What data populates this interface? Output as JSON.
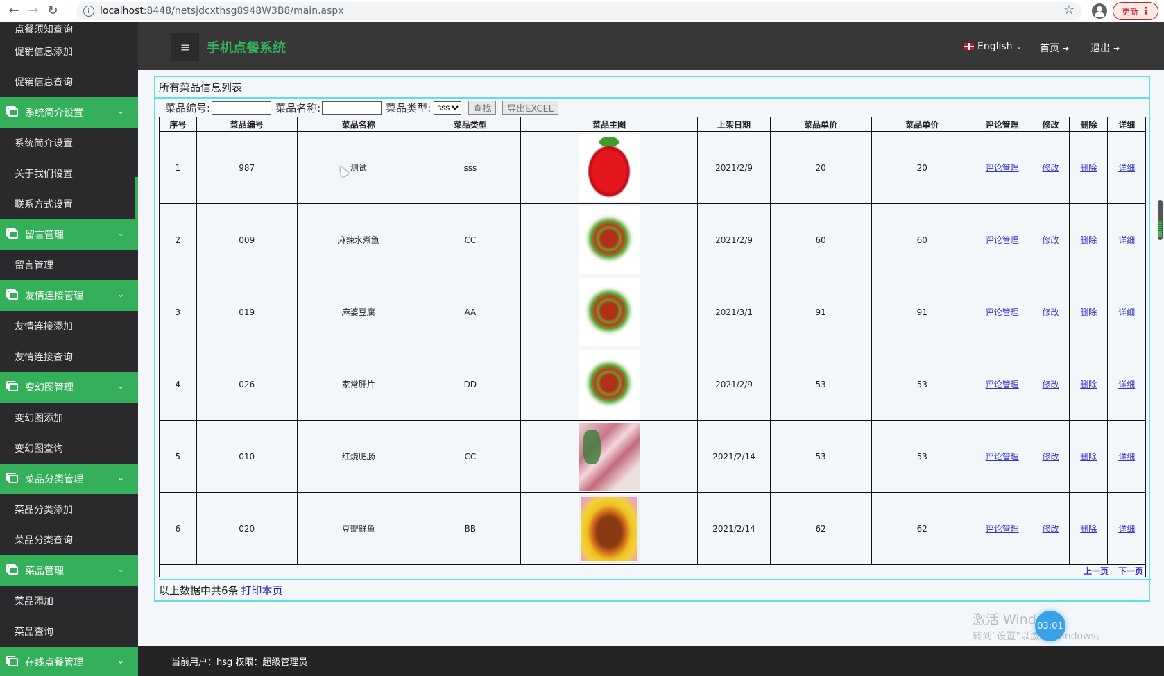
{
  "browser": {
    "url_host": "localhost",
    "url_path": ":8448/netsjdcxthsg8948W3B8/main.aspx",
    "update_label": "更新"
  },
  "sidebar": {
    "items": [
      {
        "type": "item",
        "label": "点餐须知查询"
      },
      {
        "type": "item",
        "label": "促销信息添加"
      },
      {
        "type": "item",
        "label": "促销信息查询"
      },
      {
        "type": "group",
        "label": "系统简介设置"
      },
      {
        "type": "item",
        "label": "系统简介设置"
      },
      {
        "type": "item",
        "label": "关于我们设置"
      },
      {
        "type": "item",
        "label": "联系方式设置"
      },
      {
        "type": "group",
        "label": "留言管理"
      },
      {
        "type": "item",
        "label": "留言管理"
      },
      {
        "type": "group",
        "label": "友情连接管理"
      },
      {
        "type": "item",
        "label": "友情连接添加"
      },
      {
        "type": "item",
        "label": "友情连接查询"
      },
      {
        "type": "group",
        "label": "变幻图管理"
      },
      {
        "type": "item",
        "label": "变幻图添加"
      },
      {
        "type": "item",
        "label": "变幻图查询"
      },
      {
        "type": "group",
        "label": "菜品分类管理"
      },
      {
        "type": "item",
        "label": "菜品分类添加"
      },
      {
        "type": "item",
        "label": "菜品分类查询"
      },
      {
        "type": "group",
        "label": "菜品管理"
      },
      {
        "type": "item",
        "label": "菜品添加"
      },
      {
        "type": "item",
        "label": "菜品查询"
      },
      {
        "type": "group",
        "label": "在线点餐管理"
      }
    ]
  },
  "header": {
    "title": "手机点餐系统",
    "language": "English",
    "home": "首页",
    "logout": "退出"
  },
  "panel": {
    "title": "所有菜品信息列表",
    "filter": {
      "code_label": "菜品编号:",
      "code_value": "",
      "name_label": "菜品名称:",
      "name_value": "",
      "type_label": "菜品类型:",
      "type_selected": "sss",
      "search_button": "查找",
      "export_button": "导出EXCEL"
    },
    "columns": [
      "序号",
      "菜品编号",
      "菜品名称",
      "菜品类型",
      "菜品主图",
      "上架日期",
      "菜品单价",
      "菜品单价",
      "评论管理",
      "修改",
      "删除",
      "详细"
    ],
    "rows": [
      {
        "no": "1",
        "code": "987",
        "name": "测试",
        "type": "sss",
        "image": "strawberry",
        "date": "2021/2/9",
        "price": "20",
        "price2": "20",
        "comment": "评论管理",
        "edit": "修改",
        "delete": "删除",
        "detail": "详细"
      },
      {
        "no": "2",
        "code": "009",
        "name": "麻辣水煮鱼",
        "type": "CC",
        "image": "salad",
        "date": "2021/2/9",
        "price": "60",
        "price2": "60",
        "comment": "评论管理",
        "edit": "修改",
        "delete": "删除",
        "detail": "详细"
      },
      {
        "no": "3",
        "code": "019",
        "name": "麻婆豆腐",
        "type": "AA",
        "image": "salad",
        "date": "2021/3/1",
        "price": "91",
        "price2": "91",
        "comment": "评论管理",
        "edit": "修改",
        "delete": "删除",
        "detail": "详细"
      },
      {
        "no": "4",
        "code": "026",
        "name": "家常肝片",
        "type": "DD",
        "image": "salad",
        "date": "2021/2/9",
        "price": "53",
        "price2": "53",
        "comment": "评论管理",
        "edit": "修改",
        "delete": "删除",
        "detail": "详细"
      },
      {
        "no": "5",
        "code": "010",
        "name": "红烧肥肠",
        "type": "CC",
        "image": "meat",
        "date": "2021/2/14",
        "price": "53",
        "price2": "53",
        "comment": "评论管理",
        "edit": "修改",
        "delete": "删除",
        "detail": "详细"
      },
      {
        "no": "6",
        "code": "020",
        "name": "豆瓣鲜鱼",
        "type": "BB",
        "image": "fish",
        "date": "2021/2/14",
        "price": "62",
        "price2": "62",
        "comment": "评论管理",
        "edit": "修改",
        "delete": "删除",
        "detail": "详细"
      }
    ],
    "pager": {
      "prev": "上一页",
      "next": "下一页"
    },
    "summary": "以上数据中共6条",
    "print_link": "打印本页"
  },
  "overlay": {
    "watermark_line1": "激活 Windows",
    "watermark_line2": "转到\"设置\"以激活 Windows。",
    "timer": "03:01"
  },
  "footer": {
    "text": "当前用户：hsg 权限：超级管理员"
  }
}
